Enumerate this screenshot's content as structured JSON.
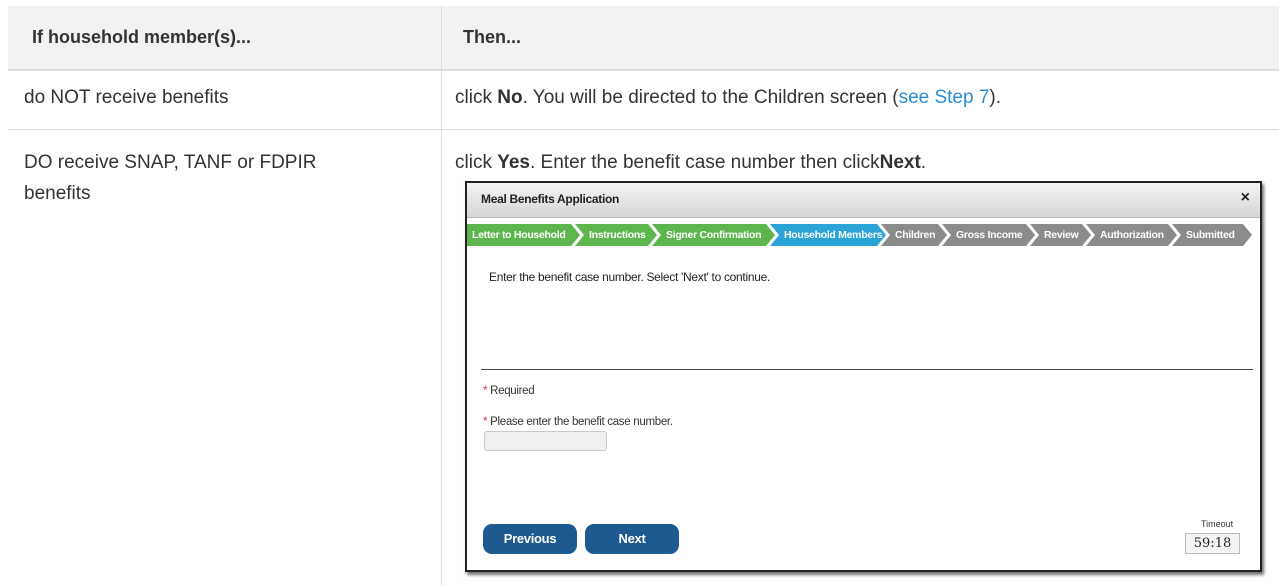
{
  "table": {
    "headers": [
      "If household member(s)...",
      "Then..."
    ],
    "rows": [
      {
        "condition": "do NOT receive benefits",
        "action_prefix": "click ",
        "action_bold": "No",
        "action_middle": ". You will be directed to the Children screen (",
        "action_link": "see Step 7",
        "action_suffix": ")."
      },
      {
        "condition_line1": "DO receive SNAP, TANF or FDPIR",
        "condition_line2": "benefits",
        "action_prefix": "click ",
        "action_bold": "Yes",
        "action_middle": ". Enter the benefit case number then click",
        "action_bold2": "Next",
        "action_suffix": "."
      }
    ]
  },
  "dialog": {
    "title": "Meal Benefits Application",
    "close_glyph": "×",
    "steps": [
      {
        "label": "Letter to Household",
        "state": "done"
      },
      {
        "label": "Instructions",
        "state": "done"
      },
      {
        "label": "Signer Confirmation",
        "state": "done"
      },
      {
        "label": "Household Members",
        "state": "current"
      },
      {
        "label": "Children",
        "state": "todo"
      },
      {
        "label": "Gross Income",
        "state": "todo"
      },
      {
        "label": "Review",
        "state": "todo"
      },
      {
        "label": "Authorization",
        "state": "todo"
      },
      {
        "label": "Submitted",
        "state": "todo"
      }
    ],
    "instruction": "Enter the benefit case number. Select 'Next' to continue.",
    "required_star": "*",
    "required_label": "Required",
    "case_number_label": "Please enter the benefit case number.",
    "case_number_value": "",
    "previous_label": "Previous",
    "next_label": "Next",
    "timeout_label": "Timeout",
    "timeout_value": "59:18"
  },
  "colors": {
    "step_done": "#5cb54d",
    "step_current": "#2aa3d6",
    "step_todo": "#8b8b8b",
    "button": "#1e5a8f",
    "link": "#2a8dd4",
    "required_star": "#d03030"
  }
}
